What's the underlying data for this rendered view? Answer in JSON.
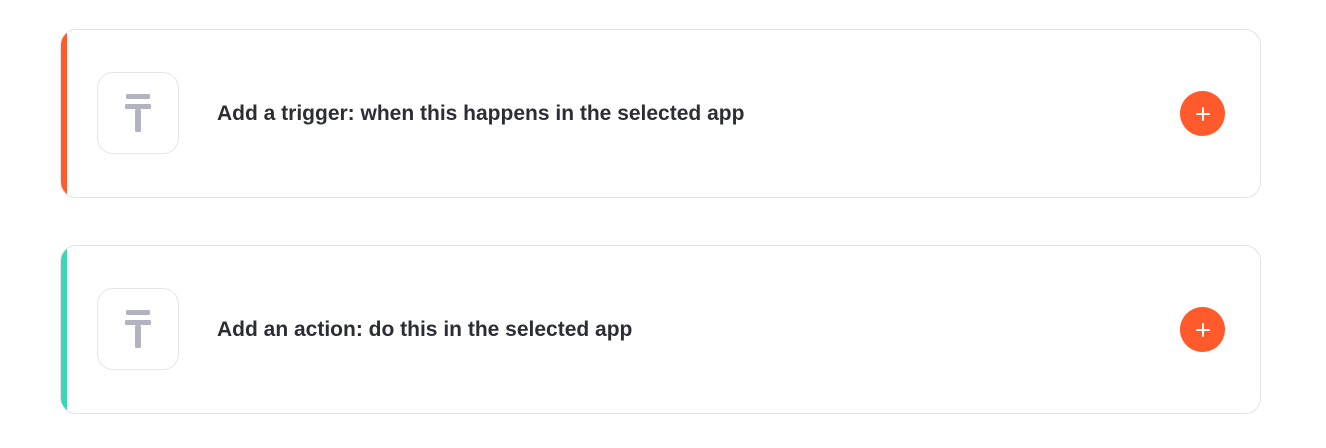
{
  "steps": [
    {
      "kind": "trigger",
      "label": "Add a trigger: when this happens in the selected app",
      "accent_color": "#ff5a2c",
      "icon": "app-placeholder-icon",
      "add_icon": "plus-icon"
    },
    {
      "kind": "action",
      "label": "Add an action: do this in the selected app",
      "accent_color": "#3dd6b5",
      "icon": "app-placeholder-icon",
      "add_icon": "plus-icon"
    }
  ],
  "colors": {
    "add_button": "#ff5a2c",
    "icon_glyph": "#b3b3c0",
    "text": "#2d2e33",
    "card_border": "#e3e3e6"
  }
}
